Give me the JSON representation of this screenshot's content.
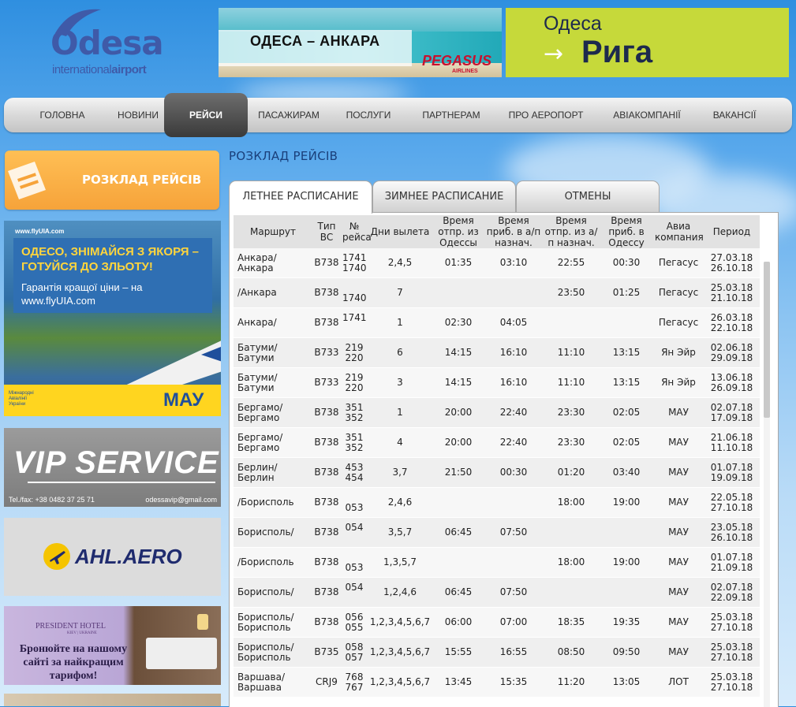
{
  "logo": {
    "word": "Odesa",
    "sub_light": "international",
    "sub_bold": "airport"
  },
  "ads": {
    "ankara": {
      "text": "ОДЕСА – АНКАРА",
      "brand": "PEGASUS",
      "brand_sub": "AIRLINES"
    },
    "riga": {
      "line1": "Одеса",
      "arrow": "→",
      "line2": "Рига"
    },
    "uia": {
      "url": "www.flyUIA.com",
      "headline": "ОДЕСО, ЗНІМАЙСЯ З ЯКОРЯ – ГОТУЙСЯ ДО ЗЛЬОТУ!",
      "body": "Гарантія кращої ціни – на www.flyUIA.com",
      "brand": "МАУ",
      "brand_small": "Міжнародні Авіалінії України"
    },
    "vip": {
      "logo": "VIP SERVICE",
      "phone": "Tel./fax: +38 0482 37 25 71",
      "email": "odessavip@gmail.com"
    },
    "ahl": {
      "text": "AHL.AERO"
    },
    "hotel": {
      "name": "PRESIDENT HOTEL",
      "sub": "KIEV | UKRAINE",
      "msg": "Бронюйте на нашому сайті за найкращим тарифом!"
    }
  },
  "nav": {
    "items": [
      {
        "label": "ГОЛОВНА",
        "active": false
      },
      {
        "label": "НОВИНИ",
        "active": false
      },
      {
        "label": "РЕЙСИ",
        "active": true
      },
      {
        "label": "ПАСАЖИРАМ",
        "active": false
      },
      {
        "label": "ПОСЛУГИ",
        "active": false
      },
      {
        "label": "ПАРТНЕРАМ",
        "active": false
      },
      {
        "label": "ПРО АЕРОПОРТ",
        "active": false
      },
      {
        "label": "АВІАКОМПАНІЇ",
        "active": false
      },
      {
        "label": "ВАКАНСІЇ",
        "active": false
      }
    ]
  },
  "sidebar": {
    "schedule_label": "РОЗКЛАД РЕЙСІВ"
  },
  "page": {
    "title": "РОЗКЛАД РЕЙСІВ"
  },
  "tabs": [
    {
      "label": "ЛЕТНЕЕ РАСПИСАНИЕ",
      "active": true
    },
    {
      "label": "ЗИМНЕЕ РАСПИСАНИЕ",
      "active": false
    },
    {
      "label": "ОТМЕНЫ",
      "active": false
    }
  ],
  "table": {
    "headers": [
      "Маршрут",
      "Тип ВС",
      "№ рейса",
      "Дни вылета",
      "Время отпр. из Одессы",
      "Время приб. в а/п назнач.",
      "Время отпр. из а/п назнач.",
      "Время приб. в Одессу",
      "Авиа компания",
      "Период"
    ],
    "rows": [
      {
        "route": "Анкара/Анкара",
        "type": "B738",
        "flight": [
          "1741",
          "1740"
        ],
        "days": "2,4,5",
        "dep_odessa": "01:35",
        "arr_dest": "03:10",
        "dep_dest": "22:55",
        "arr_odessa": "00:30",
        "airline": "Пегасус",
        "period": [
          "27.03.18",
          "26.10.18"
        ]
      },
      {
        "route": "/Анкара",
        "type": "B738",
        "flight": [
          "",
          "1740"
        ],
        "days": "7",
        "dep_odessa": "",
        "arr_dest": "",
        "dep_dest": "23:50",
        "arr_odessa": "01:25",
        "airline": "Пегасус",
        "period": [
          "25.03.18",
          "21.10.18"
        ]
      },
      {
        "route": "Анкара/",
        "type": "B738",
        "flight": [
          "1741",
          ""
        ],
        "days": "1",
        "dep_odessa": "02:30",
        "arr_dest": "04:05",
        "dep_dest": "",
        "arr_odessa": "",
        "airline": "Пегасус",
        "period": [
          "26.03.18",
          "22.10.18"
        ]
      },
      {
        "route": "Батуми/Батуми",
        "type": "B733",
        "flight": [
          "219",
          "220"
        ],
        "days": "6",
        "dep_odessa": "14:15",
        "arr_dest": "16:10",
        "dep_dest": "11:10",
        "arr_odessa": "13:15",
        "airline": "Ян Эйр",
        "period": [
          "02.06.18",
          "29.09.18"
        ]
      },
      {
        "route": "Батуми/Батуми",
        "type": "B733",
        "flight": [
          "219",
          "220"
        ],
        "days": "3",
        "dep_odessa": "14:15",
        "arr_dest": "16:10",
        "dep_dest": "11:10",
        "arr_odessa": "13:15",
        "airline": "Ян Эйр",
        "period": [
          "13.06.18",
          "26.09.18"
        ]
      },
      {
        "route": "Бергамо/ Бергамо",
        "type": "B738",
        "flight": [
          "351",
          "352"
        ],
        "days": "1",
        "dep_odessa": "20:00",
        "arr_dest": "22:40",
        "dep_dest": "23:30",
        "arr_odessa": "02:05",
        "airline": "МАУ",
        "period": [
          "02.07.18",
          "17.09.18"
        ]
      },
      {
        "route": "Бергамо/ Бергамо",
        "type": "B738",
        "flight": [
          "351",
          "352"
        ],
        "days": "4",
        "dep_odessa": "20:00",
        "arr_dest": "22:40",
        "dep_dest": "23:30",
        "arr_odessa": "02:05",
        "airline": "МАУ",
        "period": [
          "21.06.18",
          "11.10.18"
        ]
      },
      {
        "route": "Берлин/ Берлин",
        "type": "B738",
        "flight": [
          "453",
          "454"
        ],
        "days": "3,7",
        "dep_odessa": "21:50",
        "arr_dest": "00:30",
        "dep_dest": "01:20",
        "arr_odessa": "03:40",
        "airline": "МАУ",
        "period": [
          "01.07.18",
          "19.09.18"
        ]
      },
      {
        "route": "/Борисполь",
        "type": "B738",
        "flight": [
          "",
          "053"
        ],
        "days": "2,4,6",
        "dep_odessa": "",
        "arr_dest": "",
        "dep_dest": "18:00",
        "arr_odessa": "19:00",
        "airline": "МАУ",
        "period": [
          "22.05.18",
          "27.10.18"
        ]
      },
      {
        "route": "Борисполь/",
        "type": "B738",
        "flight": [
          "054",
          ""
        ],
        "days": "3,5,7",
        "dep_odessa": "06:45",
        "arr_dest": "07:50",
        "dep_dest": "",
        "arr_odessa": "",
        "airline": "МАУ",
        "period": [
          "23.05.18",
          "26.10.18"
        ]
      },
      {
        "route": "/Борисполь",
        "type": "B738",
        "flight": [
          "",
          "053"
        ],
        "days": "1,3,5,7",
        "dep_odessa": "",
        "arr_dest": "",
        "dep_dest": "18:00",
        "arr_odessa": "19:00",
        "airline": "МАУ",
        "period": [
          "01.07.18",
          "21.09.18"
        ]
      },
      {
        "route": "Борисполь/",
        "type": "B738",
        "flight": [
          "054",
          ""
        ],
        "days": "1,2,4,6",
        "dep_odessa": "06:45",
        "arr_dest": "07:50",
        "dep_dest": "",
        "arr_odessa": "",
        "airline": "МАУ",
        "period": [
          "02.07.18",
          "22.09.18"
        ]
      },
      {
        "route": "Борисполь/ Борисполь",
        "type": "B738",
        "flight": [
          "056",
          "055"
        ],
        "days": "1,2,3,4,5,6,7",
        "dep_odessa": "06:00",
        "arr_dest": "07:00",
        "dep_dest": "18:35",
        "arr_odessa": "19:35",
        "airline": "МАУ",
        "period": [
          "25.03.18",
          "27.10.18"
        ]
      },
      {
        "route": "Борисполь/ Борисполь",
        "type": "B735",
        "flight": [
          "058",
          "057"
        ],
        "days": "1,2,3,4,5,6,7",
        "dep_odessa": "15:55",
        "arr_dest": "16:55",
        "dep_dest": "08:50",
        "arr_odessa": "09:50",
        "airline": "МАУ",
        "period": [
          "25.03.18",
          "27.10.18"
        ]
      },
      {
        "route": "Варшава/ Варшава",
        "type": "CRJ9",
        "flight": [
          "768",
          "767"
        ],
        "days": "1,2,3,4,5,6,7",
        "dep_odessa": "13:45",
        "arr_dest": "15:35",
        "dep_dest": "11:20",
        "arr_odessa": "13:05",
        "airline": "ЛОТ",
        "period": [
          "25.03.18",
          "27.10.18"
        ]
      }
    ]
  }
}
